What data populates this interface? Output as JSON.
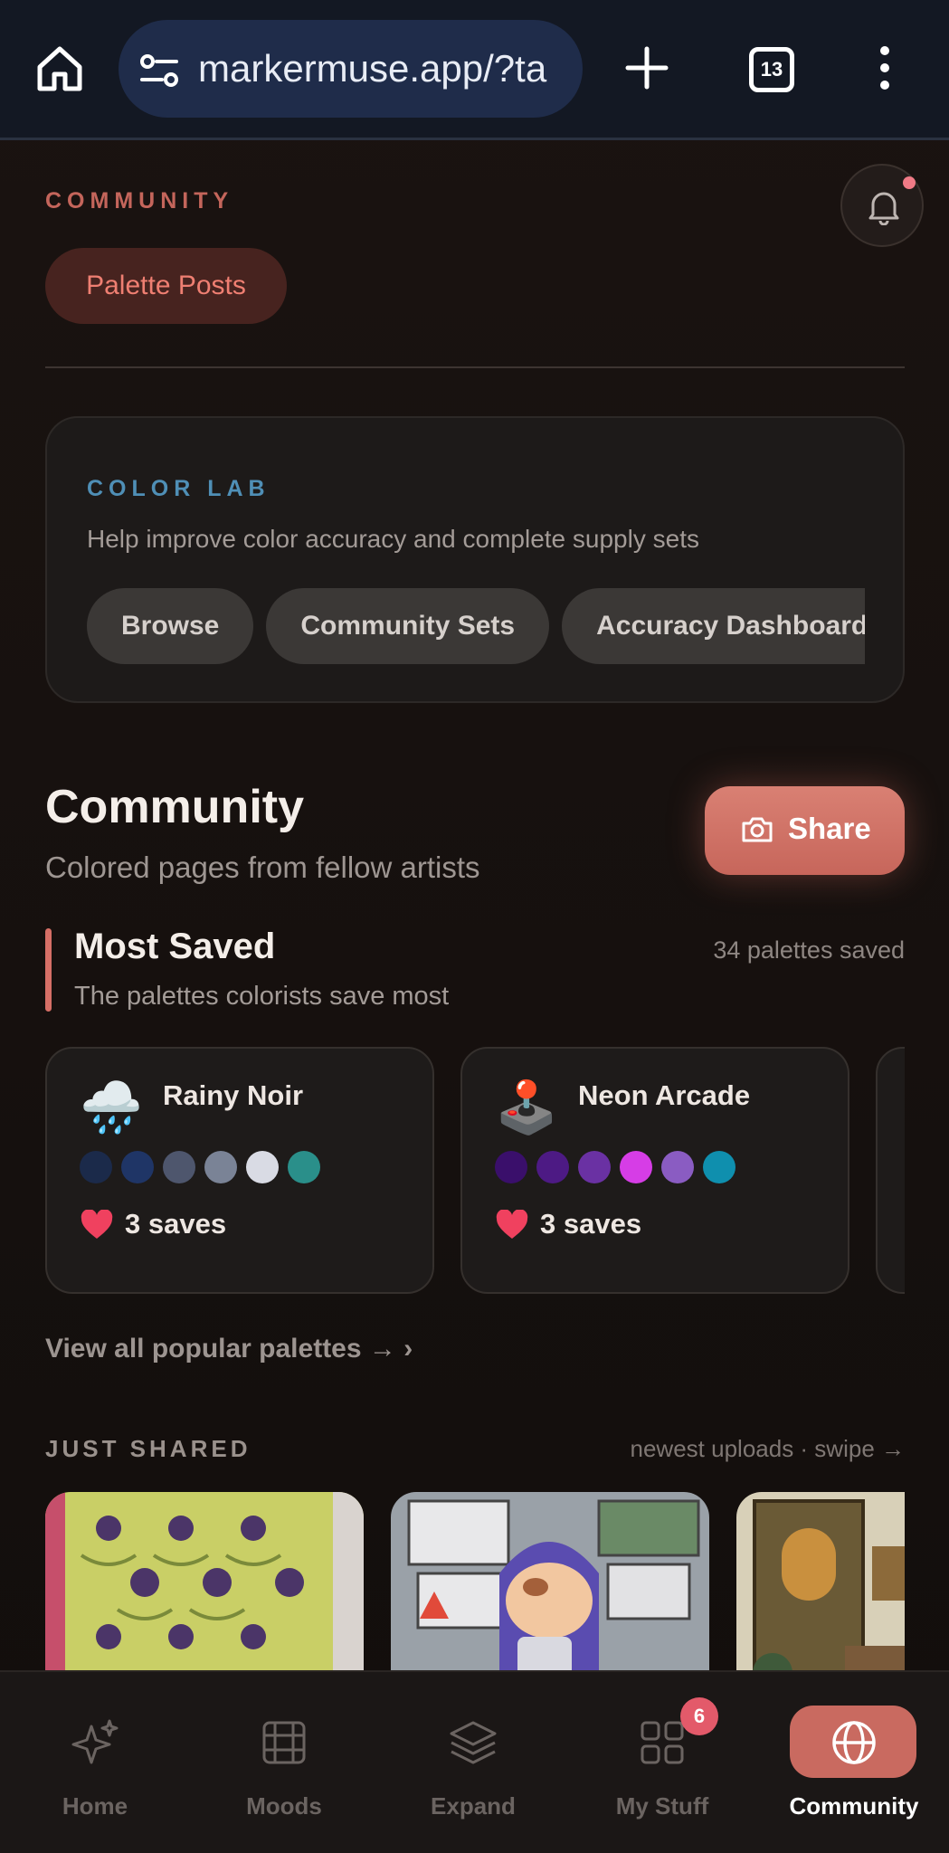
{
  "browser": {
    "url": "markermuse.app/?ta",
    "tab_count": "13"
  },
  "header": {
    "kicker": "COMMUNITY",
    "active_pill": "Palette Posts"
  },
  "color_lab": {
    "kicker": "COLOR LAB",
    "subtitle": "Help improve color accuracy and complete supply sets",
    "chips": [
      "Browse",
      "Community Sets",
      "Accuracy Dashboard"
    ]
  },
  "community": {
    "title": "Community",
    "subtitle": "Colored pages from fellow artists",
    "share_label": "Share"
  },
  "most_saved": {
    "title": "Most Saved",
    "subtitle": "The palettes colorists save most",
    "count": "34 palettes saved",
    "palettes": [
      {
        "emoji": "🌧️",
        "name": "Rainy Noir",
        "saves": "3 saves",
        "colors": [
          "#1b2a4a",
          "#1f3566",
          "#4e566d",
          "#7a8396",
          "#d9dbe4",
          "#2a8f8a"
        ]
      },
      {
        "emoji": "🕹️",
        "name": "Neon Arcade",
        "saves": "3 saves",
        "colors": [
          "#3a0f6b",
          "#4d1a84",
          "#6a31a3",
          "#d63de6",
          "#8a5cc2",
          "#0f8fae"
        ]
      }
    ],
    "view_all": "View all popular palettes →  ›"
  },
  "just_shared": {
    "title": "JUST SHARED",
    "hint": "newest uploads · swipe →"
  },
  "nav": {
    "items": [
      {
        "label": "Home",
        "icon": "sparkle-icon"
      },
      {
        "label": "Moods",
        "icon": "film-icon"
      },
      {
        "label": "Expand",
        "icon": "layers-icon"
      },
      {
        "label": "My Stuff",
        "icon": "grid-icon",
        "badge": "6"
      },
      {
        "label": "Community",
        "icon": "globe-icon",
        "active": true
      }
    ]
  },
  "colors": {
    "accent": "#c96a60",
    "kicker_red": "#c4655b",
    "kicker_blue": "#4f8fb6",
    "badge": "#e35a6a"
  }
}
